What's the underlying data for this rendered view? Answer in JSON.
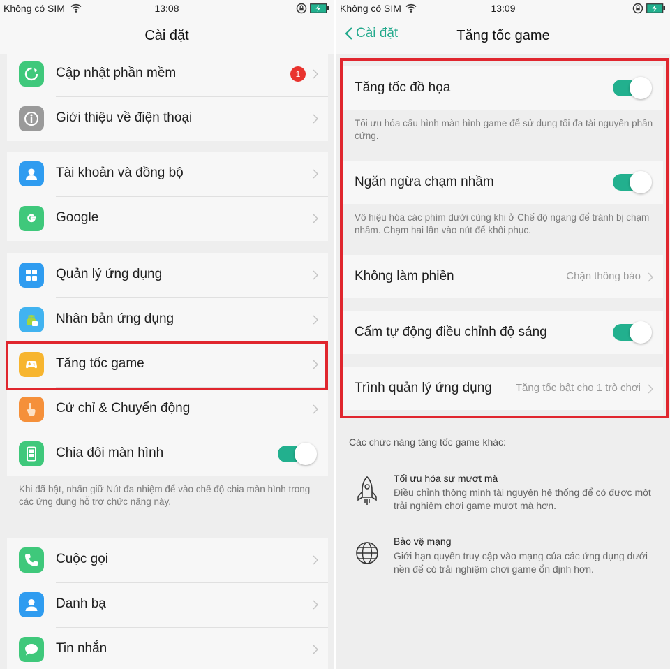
{
  "left": {
    "status": {
      "carrier": "Không có SIM",
      "time": "13:08"
    },
    "header": {
      "title": "Cài đặt"
    },
    "groups": [
      [
        {
          "label": "Cập nhật phần mềm",
          "icon": "update-icon",
          "badge": "1"
        },
        {
          "label": "Giới thiệu về điện thoại",
          "icon": "info-icon"
        }
      ],
      [
        {
          "label": "Tài khoản và đồng bộ",
          "icon": "account-icon"
        },
        {
          "label": "Google",
          "icon": "google-icon"
        }
      ],
      [
        {
          "label": "Quản lý ứng dụng",
          "icon": "app-manager-icon"
        },
        {
          "label": "Nhân bản ứng dụng",
          "icon": "app-clone-icon"
        },
        {
          "label": "Tăng tốc game",
          "icon": "game-icon"
        },
        {
          "label": "Cử chỉ & Chuyển động",
          "icon": "gesture-icon"
        },
        {
          "label": "Chia đôi màn hình",
          "icon": "split-screen-icon",
          "toggle": true
        }
      ],
      [
        {
          "label": "Cuộc gọi",
          "icon": "phone-icon"
        },
        {
          "label": "Danh bạ",
          "icon": "contacts-icon"
        },
        {
          "label": "Tin nhắn",
          "icon": "messages-icon"
        }
      ]
    ],
    "split_desc": "Khi đã bật, nhấn giữ Nút đa nhiệm để vào chế độ chia màn hình trong các ứng dụng hỗ trợ chức năng này."
  },
  "right": {
    "status": {
      "carrier": "Không có SIM",
      "time": "13:09"
    },
    "header": {
      "title": "Tăng tốc game",
      "back": "Cài đặt"
    },
    "rows": [
      {
        "label": "Tăng tốc đồ họa",
        "toggle": true,
        "desc": "Tối ưu hóa cấu hình màn hình game để sử dụng tối đa tài nguyên phần cứng."
      },
      {
        "label": "Ngăn ngừa chạm nhầm",
        "toggle": true,
        "desc": "Vô hiệu hóa các phím dưới cùng khi ở Chế độ ngang để tránh bị chạm nhầm. Chạm hai lần vào nút để khôi phục."
      },
      {
        "label": "Không làm phiền",
        "value": "Chặn thông báo"
      },
      {
        "label": "Cấm tự động điều chỉnh độ sáng",
        "toggle": true
      },
      {
        "label": "Trình quản lý ứng dụng",
        "value": "Tăng tốc bật cho 1 trò chơi"
      }
    ],
    "other_title": "Các chức năng tăng tốc game khác:",
    "features": [
      {
        "icon": "rocket-icon",
        "title": "Tối ưu hóa sự mượt mà",
        "desc": "Điều chỉnh thông minh tài nguyên hệ thống để có được một trải nghiệm chơi game mượt mà hơn."
      },
      {
        "icon": "globe-icon",
        "title": "Bảo vệ mạng",
        "desc": "Giới hạn quyền truy cập vào mạng của các ứng dụng dưới nền để có trải nghiệm chơi game ổn định hơn."
      }
    ]
  },
  "colors": {
    "accent": "#22b08e",
    "highlight": "#e0262e",
    "badge": "#e9332e"
  }
}
